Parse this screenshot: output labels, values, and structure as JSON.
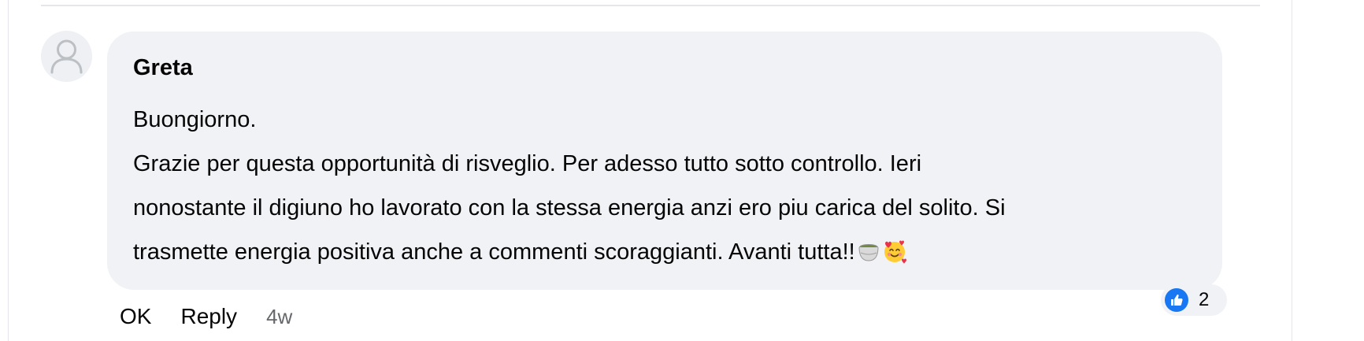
{
  "comment": {
    "author": "Greta",
    "text_lines": [
      "Buongiorno.",
      "Grazie per questa opportunità di risveglio. Per adesso tutto sotto controllo. Ieri",
      "nonostante il digiuno ho lavorato con la stessa energia anzi ero piu carica del solito. Si",
      "trasmette energia positiva anche a commenti scoraggianti. Avanti tutta!!"
    ],
    "emojis": [
      "teacup-emoji",
      "smiling-face-with-hearts-emoji"
    ]
  },
  "actions": {
    "ok_label": "OK",
    "reply_label": "Reply",
    "timestamp": "4w"
  },
  "reactions": {
    "icon": "like-icon",
    "count": "2",
    "color": "#1877f2"
  },
  "colors": {
    "bubble": "#f0f2f5",
    "text": "#050505",
    "muted": "#65676b",
    "accent": "#1877f2"
  }
}
